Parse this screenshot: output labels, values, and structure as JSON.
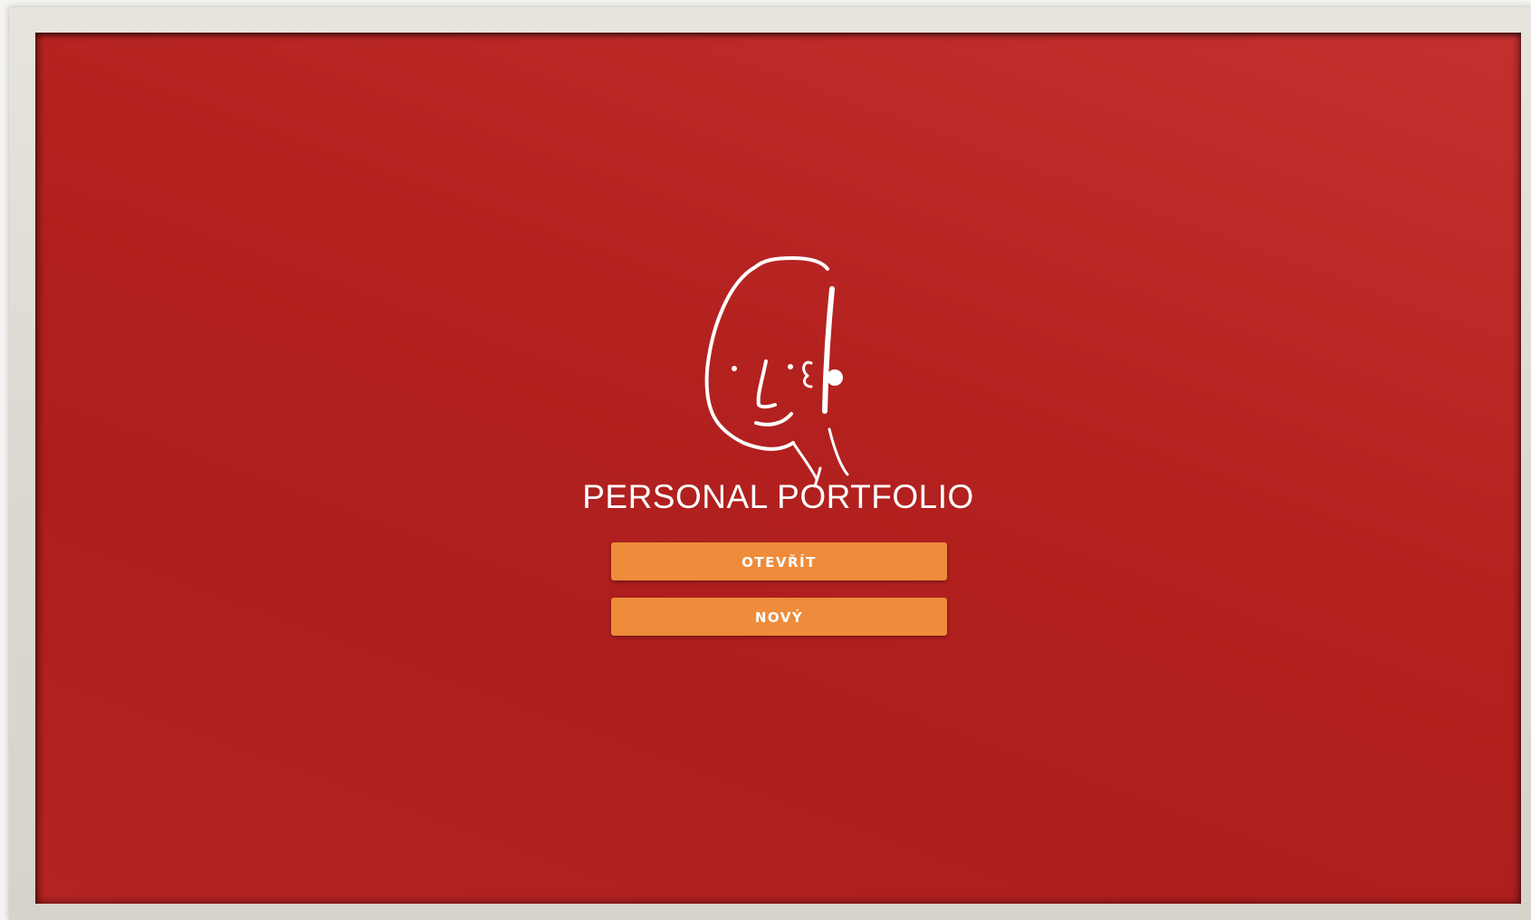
{
  "app": {
    "title": "PERSONAL PORTFOLIO",
    "logo_icon": "doodle-face-icon"
  },
  "actions": {
    "open_label": "OTEVŘÍT",
    "new_label": "NOVÝ"
  },
  "colors": {
    "background": "#b3211f",
    "button": "#ee8c3b",
    "text": "#ffffff",
    "frame": "#dcd9d1"
  }
}
